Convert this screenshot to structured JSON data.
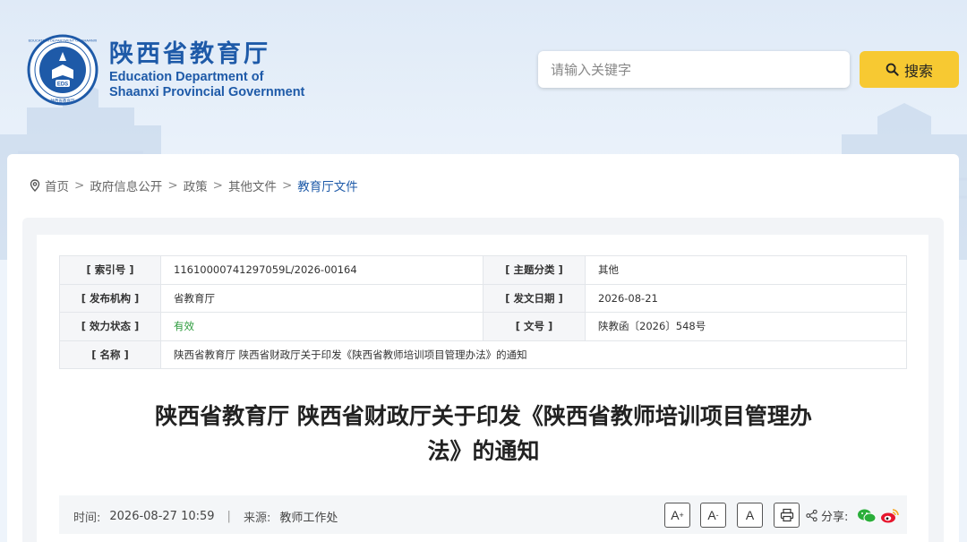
{
  "header": {
    "title_cn": "陕西省教育厅",
    "title_en_line1": "Education Department of",
    "title_en_line2": "Shaanxi Provincial Government",
    "emblem_text_top": "EDUCATION DEPARTMENT OF SHAANXI",
    "emblem_text_bottom": "陕西省教育厅",
    "emblem_abbr": "EDS"
  },
  "search": {
    "placeholder": "请输入关键字",
    "button_label": "搜索"
  },
  "breadcrumb": {
    "items": [
      "首页",
      "政府信息公开",
      "政策",
      "其他文件"
    ],
    "current": "教育厅文件"
  },
  "meta_table": {
    "index_label": "[ 索引号 ]",
    "index_value": "11610000741297059L/2026-00164",
    "topic_label": "[ 主题分类 ]",
    "topic_value": "其他",
    "publisher_label": "[ 发布机构 ]",
    "publisher_value": "省教育厅",
    "date_label": "[ 发文日期 ]",
    "date_value": "2026-08-21",
    "status_label": "[ 效力状态 ]",
    "status_value": "有效",
    "docno_label": "[ 文号 ]",
    "docno_value": "陕教函〔2026〕548号",
    "name_label": "[ 名称 ]",
    "name_value": "陕西省教育厅 陕西省财政厅关于印发《陕西省教师培训项目管理办法》的通知"
  },
  "document": {
    "title_line1": "陕西省教育厅 陕西省财政厅关于印发《陕西省教师培训项目管理办",
    "title_line2": "法》的通知"
  },
  "infobar": {
    "time_label": "时间:",
    "time_value": "2026-08-27 10:59",
    "source_label": "来源:",
    "source_value": "教师工作处",
    "font_larger": "A",
    "font_smaller": "A",
    "font_default": "A",
    "share_label": "分享:"
  },
  "colors": {
    "brand_blue": "#1e5aa8",
    "search_yellow": "#f7c932",
    "valid_green": "#2a9a3a",
    "wechat_green": "#2aae3a",
    "weibo_red": "#e6162d"
  },
  "icons": [
    "location-icon",
    "search-icon",
    "print-icon",
    "share-icon",
    "wechat-icon",
    "weibo-icon"
  ]
}
